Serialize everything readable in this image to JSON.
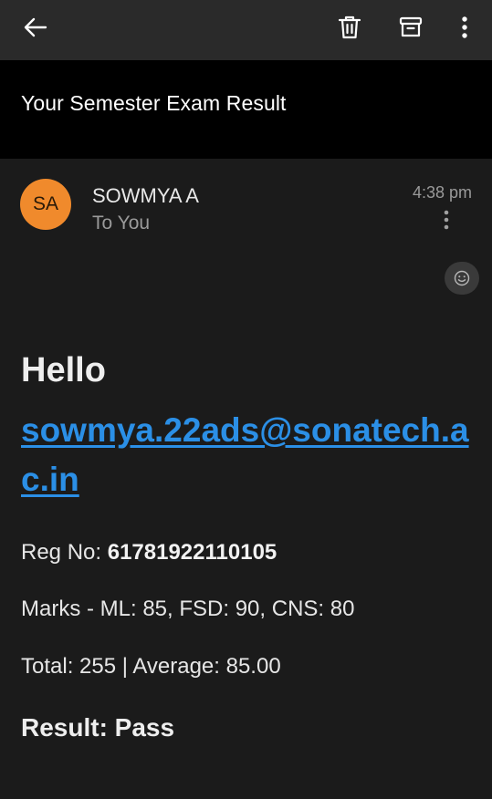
{
  "toolbar": {
    "back_icon": "arrow-left-icon",
    "delete_icon": "trash-icon",
    "archive_icon": "archive-icon",
    "more_icon": "more-vertical-icon"
  },
  "subject": "Your Semester Exam Result",
  "message": {
    "avatar_initials": "SA",
    "avatar_color": "#f08a2c",
    "sender": "SOWMYA A",
    "recipient": "To You",
    "time": "4:38 pm",
    "more_icon": "more-vertical-icon",
    "reaction_icon": "smiley-icon"
  },
  "body": {
    "greeting": "Hello",
    "email": "sowmya.22ads@sonatech.ac.in",
    "reg_label": "Reg No: ",
    "reg_value": "61781922110105",
    "marks": "Marks - ML: 85, FSD: 90, CNS: 80",
    "totals": "Total: 255 | Average: 85.00",
    "result": "Result: Pass"
  },
  "colors": {
    "background": "#1b1b1b",
    "toolbar": "#2a2a2a",
    "subject_band": "#000000",
    "link": "#2b8fe6"
  }
}
